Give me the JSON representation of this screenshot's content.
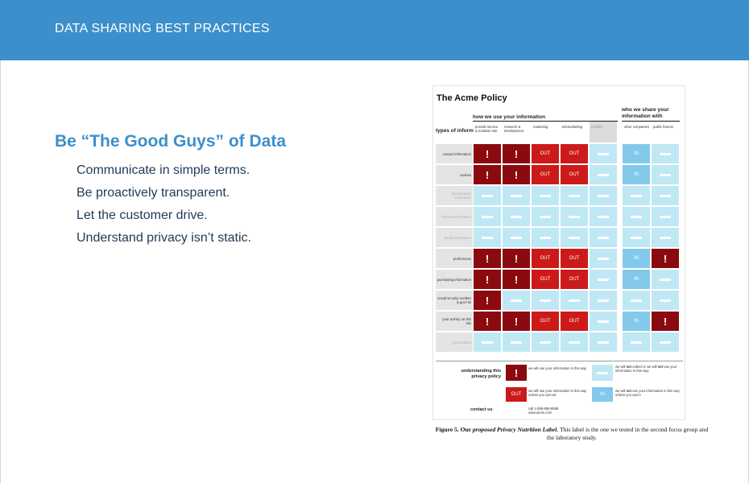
{
  "header": {
    "title": "DATA SHARING BEST PRACTICES"
  },
  "main": {
    "heading": "Be “The Good Guys” of Data",
    "bullets": [
      "Communicate in simple terms.",
      "Be proactively transparent.",
      "Let the customer drive.",
      "Understand privacy isn’t static."
    ]
  },
  "figure": {
    "title": "The Acme Policy",
    "use_heading": "how we use your information",
    "share_heading": "who we share your information with",
    "types_label": "types of information",
    "columns": [
      "provide service & maintain site",
      "research & development",
      "marketing",
      "telemarketing",
      "profiling",
      "other companies",
      "public forums"
    ],
    "rows": [
      {
        "label": "contact information",
        "faded": false,
        "cells": [
          "bang-dark",
          "bang-dark",
          "out",
          "out",
          "dash-light",
          "in",
          "dash-light"
        ]
      },
      {
        "label": "cookies",
        "faded": false,
        "cells": [
          "bang-dark",
          "bang-dark",
          "out",
          "out",
          "dash-light",
          "in",
          "dash-light"
        ]
      },
      {
        "label": "demographic information",
        "faded": true,
        "cells": [
          "dash-light",
          "dash-light",
          "dash-light",
          "dash-light",
          "dash-light",
          "dash-light",
          "dash-light"
        ]
      },
      {
        "label": "financial information",
        "faded": true,
        "cells": [
          "dash-light",
          "dash-light",
          "dash-light",
          "dash-light",
          "dash-light",
          "dash-light",
          "dash-light"
        ]
      },
      {
        "label": "health information",
        "faded": true,
        "cells": [
          "dash-light",
          "dash-light",
          "dash-light",
          "dash-light",
          "dash-light",
          "dash-light",
          "dash-light"
        ]
      },
      {
        "label": "preferences",
        "faded": false,
        "cells": [
          "bang-dark",
          "bang-dark",
          "out",
          "out",
          "dash-light",
          "in",
          "bang-dark"
        ]
      },
      {
        "label": "purchasing information",
        "faded": false,
        "cells": [
          "bang-dark",
          "bang-dark",
          "out",
          "out",
          "dash-light",
          "in",
          "dash-light"
        ]
      },
      {
        "label": "social security number & gov't ID",
        "faded": false,
        "cells": [
          "bang-dark",
          "dash-light",
          "dash-light",
          "dash-light",
          "dash-light",
          "dash-light",
          "dash-light"
        ]
      },
      {
        "label": "your activity on this site",
        "faded": false,
        "cells": [
          "bang-dark",
          "bang-dark",
          "out",
          "out",
          "dash-light",
          "in",
          "bang-dark"
        ]
      },
      {
        "label": "your location",
        "faded": true,
        "cells": [
          "dash-light",
          "dash-light",
          "dash-light",
          "dash-light",
          "dash-light",
          "dash-light",
          "dash-light"
        ]
      }
    ],
    "cell_text": {
      "bang": "!",
      "out": "OUT",
      "in": "IN"
    },
    "legend": {
      "label": "understanding this privacy policy",
      "bang_text_pre": "we will use your information in this way",
      "dash_text_pre": "we will ",
      "dash_text_bold1": "not",
      "dash_text_mid": " collect or we will ",
      "dash_text_bold2": "not",
      "dash_text_post": " use your information in this way",
      "out_text": "we will use your information in this way unless you opt-out",
      "in_text_pre": "we will ",
      "in_text_bold": "not",
      "in_text_post": " use your information in this way unless you opt-in"
    },
    "contact": {
      "label": "contact us",
      "phone": "call 1-888-888-8888",
      "web": "www.acme.com"
    }
  },
  "caption": {
    "prefix": "Figure 5. Our ",
    "italic": "proposed Privacy Nutrition Label.",
    "rest": " This label is the one we tested in the second focus group and the laboratory study."
  },
  "colors": {
    "header": "#3d8fcb",
    "dark_red": "#8b0a10",
    "red": "#cc1a1a",
    "light_blue": "#bfe8f4",
    "blue": "#82c9ec"
  }
}
